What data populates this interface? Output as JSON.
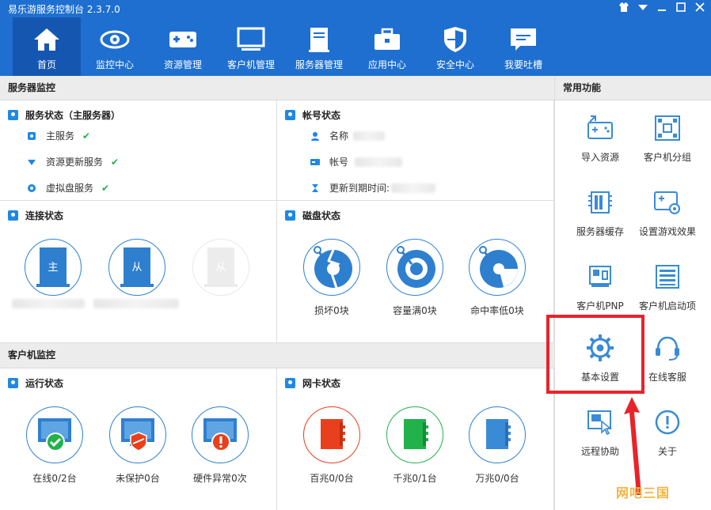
{
  "app": {
    "title": "易乐游服务控制台 2.3.7.0"
  },
  "nav": [
    {
      "label": "首页",
      "icon": "home-icon",
      "active": true
    },
    {
      "label": "监控中心",
      "icon": "eye-icon"
    },
    {
      "label": "资源管理",
      "icon": "gamepad-icon"
    },
    {
      "label": "客户机管理",
      "icon": "monitor-icon"
    },
    {
      "label": "服务器管理",
      "icon": "server-icon"
    },
    {
      "label": "应用中心",
      "icon": "toolbox-icon"
    },
    {
      "label": "安全中心",
      "icon": "shield-icon"
    },
    {
      "label": "我要吐槽",
      "icon": "feedback-icon"
    }
  ],
  "server_monitor": {
    "title": "服务器监控",
    "service_status": {
      "title": "服务状态（主服务器）",
      "items": [
        "主服务",
        "资源更新服务",
        "虚拟盘服务"
      ]
    },
    "account_status": {
      "title": "帐号状态",
      "name_label": "名称",
      "account_label": "帐号",
      "expire_label": "更新到期时间:"
    },
    "connection_status": {
      "title": "连接状态",
      "main": "主",
      "slave": "从",
      "slave2": "从"
    },
    "disk_status": {
      "title": "磁盘状态",
      "items": [
        "损坏0块",
        "容量满0块",
        "命中率低0块"
      ]
    }
  },
  "client_monitor": {
    "title": "客户机监控",
    "run_status": {
      "title": "运行状态",
      "items": [
        "在线0/2台",
        "未保护0台",
        "硬件异常0次"
      ]
    },
    "nic_status": {
      "title": "网卡状态",
      "items": [
        "百兆0/0台",
        "千兆0/1台",
        "万兆0/0台"
      ]
    }
  },
  "common": {
    "title": "常用功能",
    "items": [
      "导入资源",
      "客户机分组",
      "服务器缓存",
      "设置游戏效果",
      "客户机PNP",
      "客户机启动项",
      "基本设置",
      "在线客服",
      "远程协助",
      "关于"
    ]
  },
  "watermark": "网吧三国",
  "colors": {
    "accent": "#1e6fd0",
    "check": "#20b050",
    "highlight": "#e8232a",
    "red": "#e8401c",
    "green": "#21b24b",
    "blue": "#3a8bd6"
  }
}
